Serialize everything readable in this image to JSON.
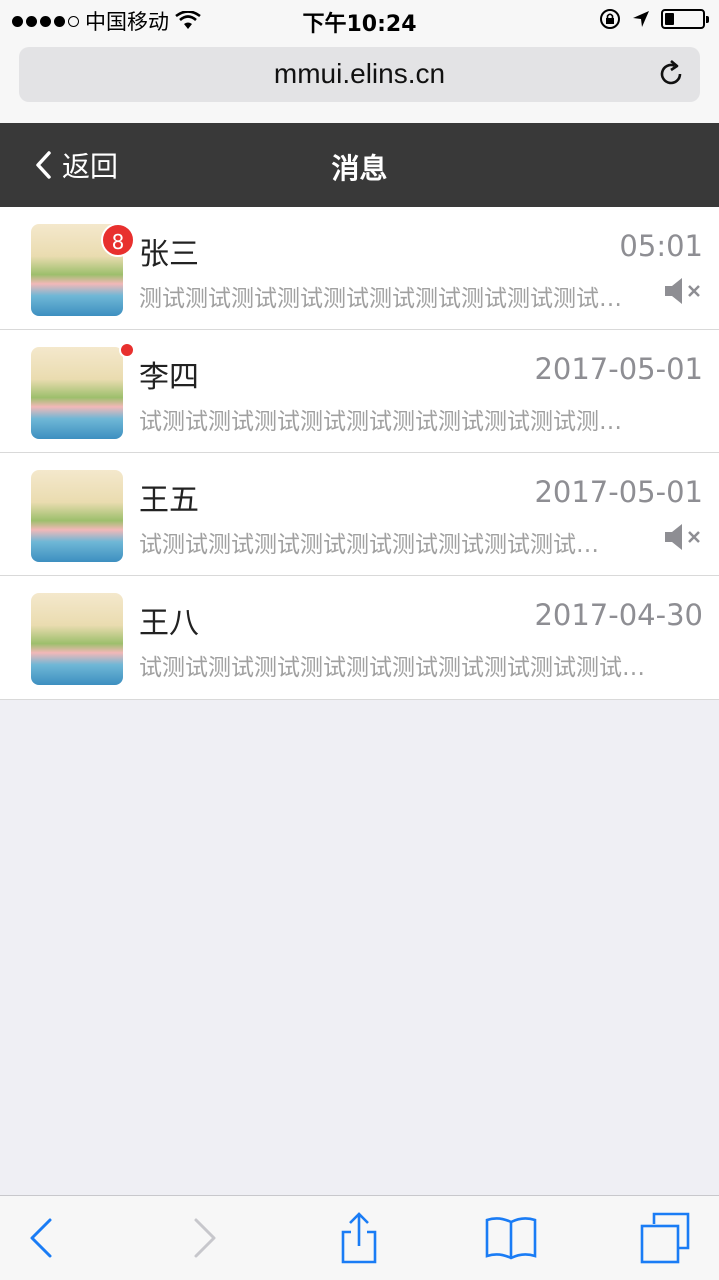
{
  "status_bar": {
    "carrier": "中国移动",
    "time": "下午10:24",
    "battery_level": 0.25
  },
  "browser": {
    "url": "mmui.elins.cn"
  },
  "header": {
    "back_label": "返回",
    "title": "消息"
  },
  "messages": [
    {
      "name": "张三",
      "time": "05:01",
      "preview": "测试测试测试测试测试测试测试测试测试测试…",
      "badge": "8",
      "muted": true
    },
    {
      "name": "李四",
      "time": "2017-05-01",
      "preview": "试测试测试测试测试测试测试测试测试测试测…",
      "dot": true,
      "muted": false
    },
    {
      "name": "王五",
      "time": "2017-05-01",
      "preview": "试测试测试测试测试测试测试测试测试测试…",
      "muted": true
    },
    {
      "name": "王八",
      "time": "2017-04-30",
      "preview": "试测试测试测试测试测试测试测试测试测试测试…",
      "muted": false
    }
  ],
  "colors": {
    "header_bg": "#393939",
    "badge_red": "#e8302e",
    "ios_blue": "#1a7cf5"
  }
}
